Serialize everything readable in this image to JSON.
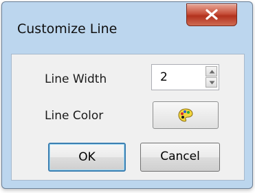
{
  "window": {
    "title": "Customize Line"
  },
  "fields": {
    "line_width": {
      "label": "Line Width",
      "value": "2"
    },
    "line_color": {
      "label": "Line Color",
      "icon": "color-palette-icon"
    }
  },
  "buttons": {
    "ok": "OK",
    "cancel": "Cancel"
  },
  "colors": {
    "title_bar": "#bcd6ee",
    "close_button": "#c7503b",
    "client_bg": "#f0f0f0"
  }
}
